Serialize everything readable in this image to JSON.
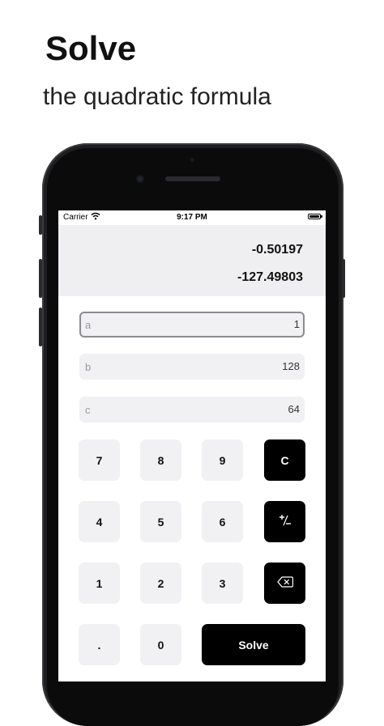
{
  "headline": "Solve",
  "subheadline": "the quadratic formula",
  "status_bar": {
    "carrier": "Carrier",
    "time": "9:17 PM"
  },
  "results": {
    "root1": "-0.50197",
    "root2": "-127.49803"
  },
  "inputs": [
    {
      "label": "a",
      "value": "1"
    },
    {
      "label": "b",
      "value": "128"
    },
    {
      "label": "c",
      "value": "64"
    }
  ],
  "keypad": {
    "k7": "7",
    "k8": "8",
    "k9": "9",
    "clear": "C",
    "k4": "4",
    "k5": "5",
    "k6": "6",
    "sign": "+/-",
    "k1": "1",
    "k2": "2",
    "k3": "3",
    "dot": ".",
    "k0": "0",
    "solve": "Solve"
  },
  "icons": {
    "wifi": "wifi-icon",
    "battery": "battery-icon",
    "backspace": "backspace-icon",
    "sign": "plus-minus-icon"
  },
  "colors": {
    "accent_dark_key": "#000000",
    "light_key": "#f1f1f3",
    "results_bg": "#efeff1"
  }
}
